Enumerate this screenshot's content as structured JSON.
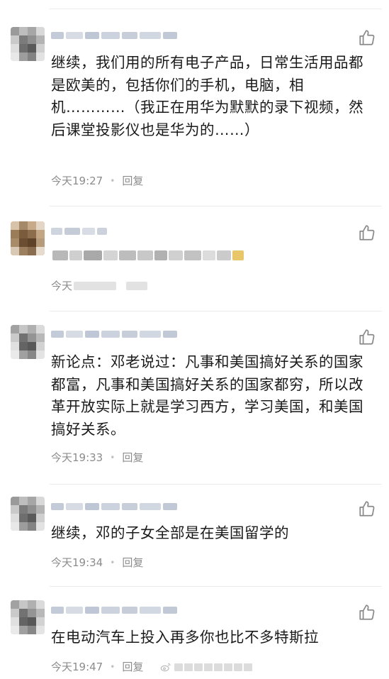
{
  "comments": [
    {
      "text": "继续，我们用的所有电子产品，日常生活用品都是欧美的，包括你们的手机，电脑，相机…………（我正在用华为默默的录下视频，然后课堂投影仪也是华为的……）",
      "time": "今天19:27",
      "reply": "回复"
    },
    {
      "text": "",
      "time": "今天",
      "reply": ""
    },
    {
      "text": "新论点：邓老说过：凡事和美国搞好关系的国家都富，凡事和美国搞好关系的国家都穷，所以改革开放实际上就是学习西方，学习美国，和美国搞好关系。",
      "time": "今天19:33",
      "reply": "回复"
    },
    {
      "text": "继续，邓的子女全部是在美国留学的",
      "time": "今天19:34",
      "reply": "回复"
    },
    {
      "text": "在电动汽车上投入再多你也比不多特斯拉",
      "time": "今天19:47",
      "reply": "回复"
    }
  ],
  "icons": {
    "like": "thumbs-up-icon",
    "watermark": "weibo-icon"
  },
  "colors": {
    "meta_text": "#8c8c8c",
    "body_text": "#1a1a1a",
    "divider": "#ececec"
  }
}
